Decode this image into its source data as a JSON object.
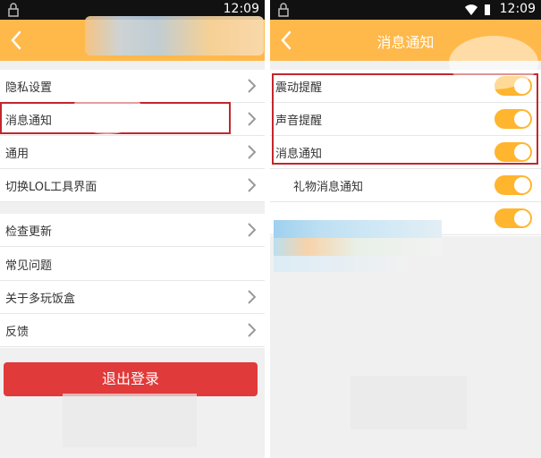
{
  "status_time": "12:09",
  "left_screen": {
    "section1": [
      {
        "label": "隐私设置"
      },
      {
        "label": "消息通知"
      },
      {
        "label": "通用"
      },
      {
        "label": "切换LOL工具界面"
      }
    ],
    "section2": [
      {
        "label": "检查更新"
      },
      {
        "label": "常见问题"
      },
      {
        "label": "关于多玩饭盒"
      },
      {
        "label": "反馈"
      }
    ],
    "logout_label": "退出登录"
  },
  "right_screen": {
    "title": "消息通知",
    "items": [
      {
        "label": "震动提醒",
        "on": true
      },
      {
        "label": "声音提醒",
        "on": true
      },
      {
        "label": "消息通知",
        "on": true
      },
      {
        "label": "礼物消息通知",
        "on": true
      },
      {
        "label": "",
        "on": true
      }
    ]
  },
  "colors": {
    "appbar": "#ffb84a",
    "toggle_on": "#ffb52e",
    "logout": "#e03a3a",
    "highlight": "#c1272d"
  }
}
